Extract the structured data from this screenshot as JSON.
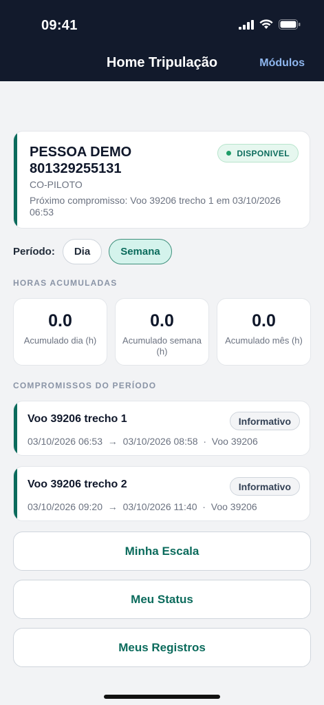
{
  "status_bar": {
    "time": "09:41"
  },
  "nav": {
    "title": "Home Tripulação",
    "action": "Módulos"
  },
  "profile": {
    "name": "PESSOA DEMO",
    "id": "801329255131",
    "role": "CO-PILOTO",
    "next_commitment": "Próximo compromisso: Voo 39206 trecho 1 em 03/10/2026 06:53",
    "status": "DISPONIVEL"
  },
  "period": {
    "label": "Período:",
    "options": [
      "Dia",
      "Semana"
    ],
    "selected": "Semana"
  },
  "hours": {
    "section_title": "HORAS ACUMULADAS",
    "stats": [
      {
        "value": "0.0",
        "label": "Acumulado dia (h)"
      },
      {
        "value": "0.0",
        "label": "Acumulado semana (h)"
      },
      {
        "value": "0.0",
        "label": "Acumulado mês (h)"
      }
    ]
  },
  "commitments": {
    "section_title": "COMPROMISSOS DO PERÍODO",
    "items": [
      {
        "title": "Voo 39206 trecho 1",
        "tag": "Informativo",
        "start": "03/10/2026 06:53",
        "arrow": "→",
        "end": "03/10/2026 08:58",
        "sep": "·",
        "flight": "Voo 39206"
      },
      {
        "title": "Voo 39206 trecho 2",
        "tag": "Informativo",
        "start": "03/10/2026 09:20",
        "arrow": "→",
        "end": "03/10/2026 11:40",
        "sep": "·",
        "flight": "Voo 39206"
      }
    ]
  },
  "actions": [
    "Minha Escala",
    "Meu Status",
    "Meus Registros"
  ],
  "colors": {
    "header": "#121a2c",
    "accent": "#0b6b5c",
    "link": "#8fb7ef",
    "status_dot": "#1f9d68"
  }
}
